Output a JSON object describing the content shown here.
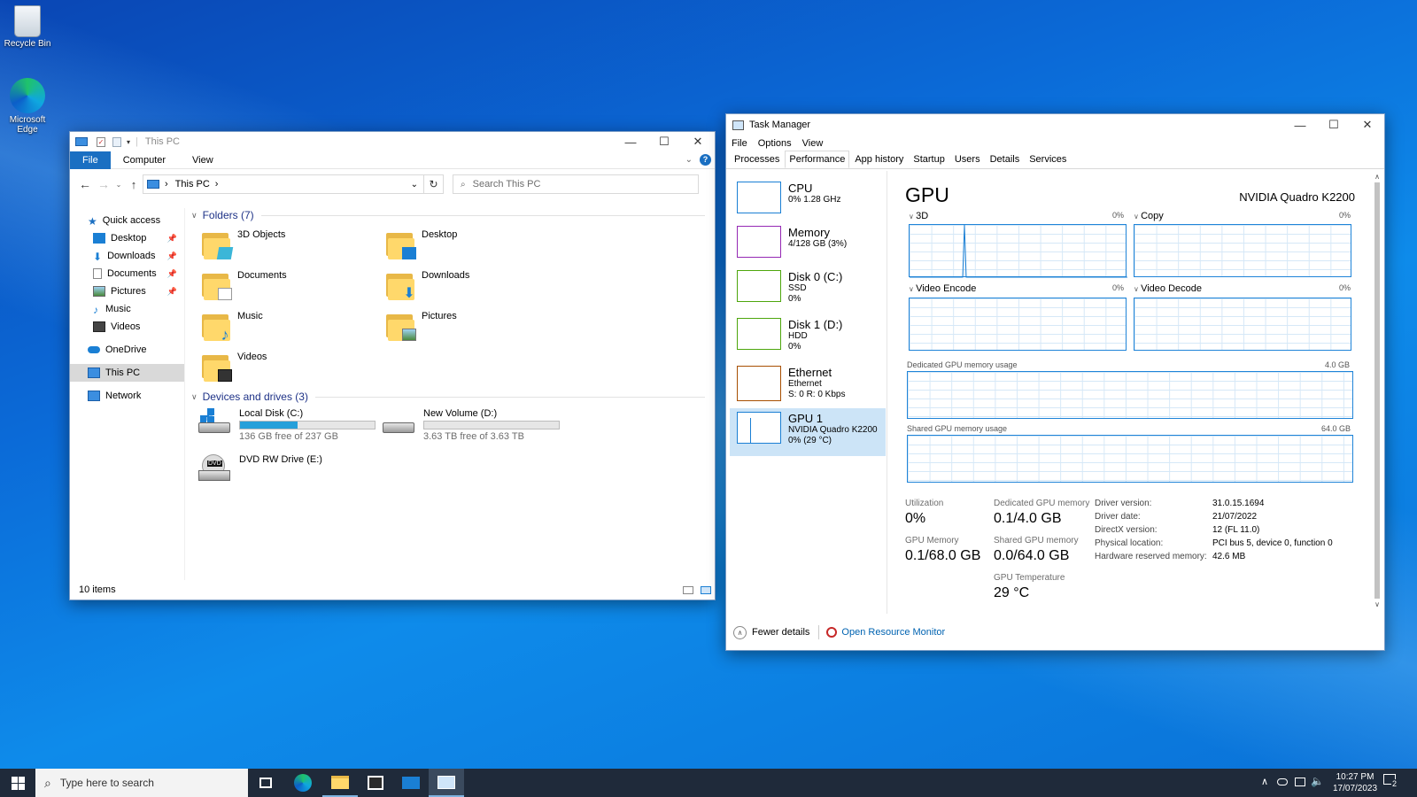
{
  "desktop": {
    "icons": [
      {
        "label": "Recycle Bin"
      },
      {
        "label": "Microsoft Edge"
      }
    ]
  },
  "explorer": {
    "title": "This PC",
    "ribbon_tabs": [
      "File",
      "Computer",
      "View"
    ],
    "address": "This PC",
    "search_placeholder": "Search This PC",
    "nav": {
      "quick_access": "Quick access",
      "items": [
        "Desktop",
        "Downloads",
        "Documents",
        "Pictures",
        "Music",
        "Videos"
      ],
      "onedrive": "OneDrive",
      "this_pc": "This PC",
      "network": "Network"
    },
    "folders_header": "Folders (7)",
    "folders": [
      "3D Objects",
      "Desktop",
      "Documents",
      "Downloads",
      "Music",
      "Pictures",
      "Videos"
    ],
    "drives_header": "Devices and drives (3)",
    "drives": [
      {
        "name": "Local Disk (C:)",
        "free": "136 GB free of 237 GB",
        "used_fraction": 0.43
      },
      {
        "name": "New Volume (D:)",
        "free": "3.63 TB free of 3.63 TB",
        "used_fraction": 0.0
      },
      {
        "name": "DVD RW Drive (E:)",
        "dvd": "DVD"
      }
    ],
    "status": "10 items"
  },
  "taskman": {
    "title": "Task Manager",
    "menu": [
      "File",
      "Options",
      "View"
    ],
    "tabs": [
      "Processes",
      "Performance",
      "App history",
      "Startup",
      "Users",
      "Details",
      "Services"
    ],
    "side": [
      {
        "title": "CPU",
        "l1": "0% 1.28 GHz",
        "l2": "",
        "l3": "",
        "color": "#1a7fd4"
      },
      {
        "title": "Memory",
        "l1": "4/128 GB (3%)",
        "l2": "",
        "l3": "",
        "color": "#9528b4"
      },
      {
        "title": "Disk 0 (C:)",
        "l1": "SSD",
        "l2": "0%",
        "l3": "",
        "color": "#4da60c"
      },
      {
        "title": "Disk 1 (D:)",
        "l1": "HDD",
        "l2": "0%",
        "l3": "",
        "color": "#4da60c"
      },
      {
        "title": "Ethernet",
        "l1": "Ethernet",
        "l2": "S: 0 R: 0 Kbps",
        "l3": "",
        "color": "#a74f01"
      },
      {
        "title": "GPU 1",
        "l1": "NVIDIA Quadro K2200",
        "l2": "0% (29 °C)",
        "l3": "",
        "color": "#1a7fd4"
      }
    ],
    "gpu_title": "GPU",
    "gpu_model": "NVIDIA Quadro K2200",
    "engines": [
      {
        "name": "3D",
        "pct": "0%"
      },
      {
        "name": "Copy",
        "pct": "0%"
      },
      {
        "name": "Video Encode",
        "pct": "0%"
      },
      {
        "name": "Video Decode",
        "pct": "0%"
      }
    ],
    "dedicated_label": "Dedicated GPU memory usage",
    "dedicated_max": "4.0 GB",
    "shared_label": "Shared GPU memory usage",
    "shared_max": "64.0 GB",
    "stats": {
      "utilization_l": "Utilization",
      "utilization_v": "0%",
      "dedicated_l": "Dedicated GPU memory",
      "dedicated_v": "0.1/4.0 GB",
      "gpumem_l": "GPU Memory",
      "gpumem_v": "0.1/68.0 GB",
      "shared_l": "Shared GPU memory",
      "shared_v": "0.0/64.0 GB",
      "temp_l": "GPU Temperature",
      "temp_v": "29 °C"
    },
    "info": [
      {
        "k": "Driver version:",
        "v": "31.0.15.1694"
      },
      {
        "k": "Driver date:",
        "v": "21/07/2022"
      },
      {
        "k": "DirectX version:",
        "v": "12 (FL 11.0)"
      },
      {
        "k": "Physical location:",
        "v": "PCI bus 5, device 0, function 0"
      },
      {
        "k": "Hardware reserved memory:",
        "v": "42.6 MB"
      }
    ],
    "fewer": "Fewer details",
    "resmon": "Open Resource Monitor"
  },
  "taskbar": {
    "search_placeholder": "Type here to search",
    "time": "10:27 PM",
    "date": "17/07/2023",
    "notif_count": "2"
  }
}
